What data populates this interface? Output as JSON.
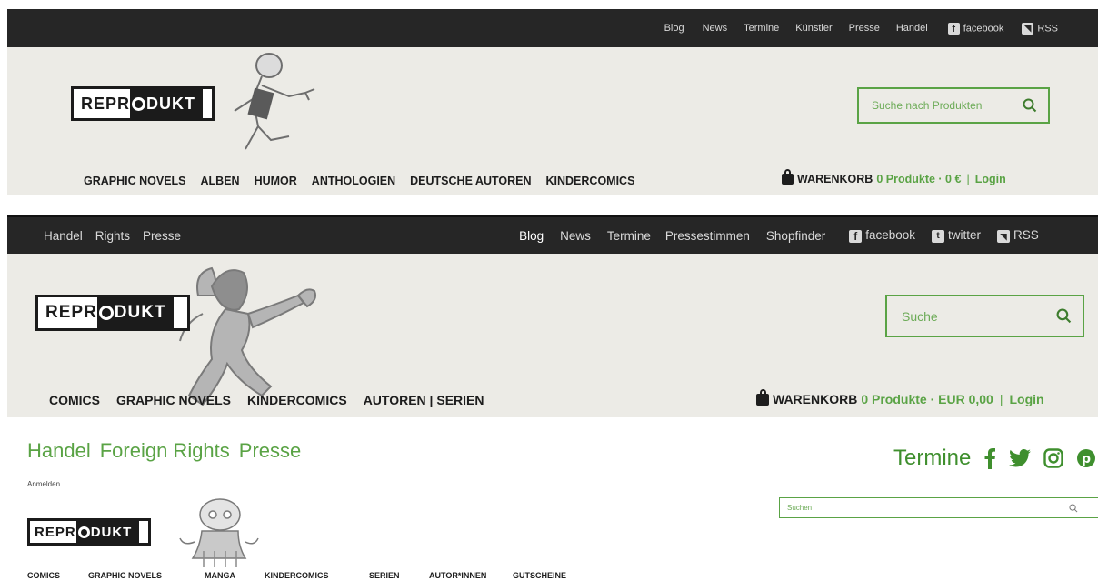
{
  "v1": {
    "topnav": [
      "Blog",
      "News",
      "Termine",
      "Künstler",
      "Presse",
      "Handel"
    ],
    "facebook": "facebook",
    "rss": "RSS",
    "logo_left": "REPR",
    "logo_o": "O",
    "logo_right": "DUKT",
    "search_placeholder": "Suche nach Produkten",
    "nav": [
      "GRAPHIC NOVELS",
      "ALBEN",
      "HUMOR",
      "ANTHOLOGIEN",
      "DEUTSCHE AUTOREN",
      "KINDERCOMICS"
    ],
    "cart_label": "WARENKORB",
    "cart_info": "0 Produkte · 0 €",
    "separator": "|",
    "login": "Login"
  },
  "v2": {
    "left_links": [
      "Handel",
      "Rights",
      "Presse"
    ],
    "right_links": [
      "Blog",
      "News",
      "Termine",
      "Pressestimmen",
      "Shopfinder"
    ],
    "facebook": "facebook",
    "twitter": "twitter",
    "rss": "RSS",
    "logo_left": "REPR",
    "logo_o": "O",
    "logo_right": "DUKT",
    "search_placeholder": "Suche",
    "nav": [
      "COMICS",
      "GRAPHIC NOVELS",
      "KINDERCOMICS",
      "AUTOREN | SERIEN"
    ],
    "cart_label": "WARENKORB",
    "cart_info": "0 Produkte · EUR 0,00",
    "separator": "|",
    "login": "Login"
  },
  "v3": {
    "links": [
      "Handel",
      "Foreign Rights",
      "Presse"
    ],
    "termine": "Termine",
    "anmelden": "Anmelden",
    "search_placeholder": "Suchen",
    "logo_left": "REPR",
    "logo_o": "O",
    "logo_right": "DUKT",
    "nav": [
      "COMICS",
      "GRAPHIC NOVELS",
      "MANGA",
      "KINDERCOMICS",
      "SERIEN",
      "AUTOR*INNEN",
      "GUTSCHEINE"
    ]
  },
  "colors": {
    "accent": "#5aa345",
    "dark": "#262626",
    "paper": "#ecebe6"
  }
}
